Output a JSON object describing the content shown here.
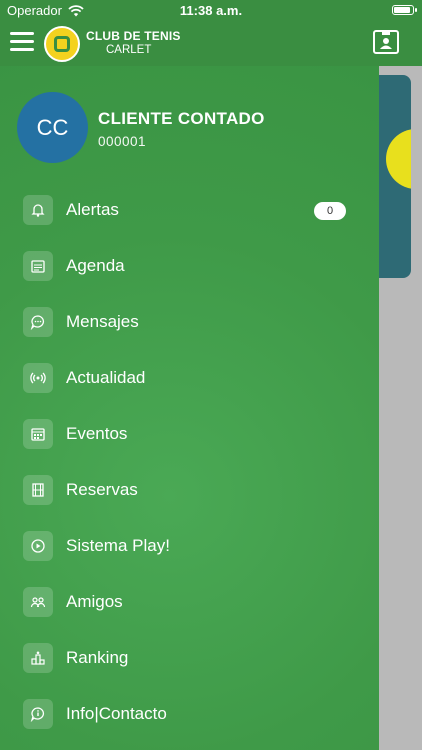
{
  "status_bar": {
    "carrier": "Operador",
    "time": "11:38 a.m."
  },
  "header": {
    "brand_line1": "CLUB DE TENIS",
    "brand_line2": "CARLET"
  },
  "user": {
    "initials": "CC",
    "name": "CLIENTE CONTADO",
    "code": "000001"
  },
  "menu": [
    {
      "label": "Alertas",
      "icon": "bell-icon",
      "badge": "0"
    },
    {
      "label": "Agenda",
      "icon": "calendar-list-icon"
    },
    {
      "label": "Mensajes",
      "icon": "chat-bubble-icon"
    },
    {
      "label": "Actualidad",
      "icon": "broadcast-icon"
    },
    {
      "label": "Eventos",
      "icon": "calendar-grid-icon"
    },
    {
      "label": "Reservas",
      "icon": "court-icon"
    },
    {
      "label": "Sistema Play!",
      "icon": "play-logo-icon"
    },
    {
      "label": "Amigos",
      "icon": "friends-icon"
    },
    {
      "label": "Ranking",
      "icon": "podium-icon"
    },
    {
      "label": "Info|Contacto",
      "icon": "info-chat-icon"
    }
  ],
  "colors": {
    "brand_green": "#3a8e41",
    "drawer_green": "#3f9a48",
    "avatar_blue": "#2471a3",
    "logo_yellow": "#f4d21f"
  }
}
